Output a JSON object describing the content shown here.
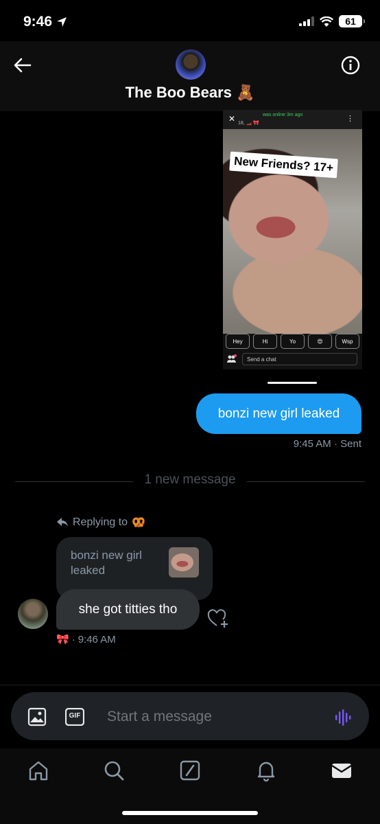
{
  "status_bar": {
    "time": "9:46",
    "battery": "61"
  },
  "header": {
    "title": "The Boo Bears 🧸"
  },
  "shared_image": {
    "status_text": "was online 3m ago",
    "sub_text": "18, 🏎️ 🎀",
    "sticker": "New Friends? 17+",
    "quick_replies": [
      "Hey",
      "Hi",
      "Yo",
      "😍",
      "Wsp"
    ],
    "send_chat": "Send a chat"
  },
  "sent_message": {
    "text": "bonzi new girl leaked",
    "time": "9:45 AM",
    "status": "Sent"
  },
  "new_message_divider": "1 new message",
  "received_message": {
    "replying_to_label": "Replying to",
    "replying_to_emoji": "🥨",
    "quoted_text": "bonzi new girl leaked",
    "text": "she got titties tho",
    "reaction_emoji": "🎀",
    "time": "9:46 AM"
  },
  "composer": {
    "placeholder": "Start a message",
    "gif_label": "GIF"
  },
  "colors": {
    "accent": "#1d9bf0",
    "bubble_received": "#2f3336",
    "voice": "#7856ff"
  }
}
